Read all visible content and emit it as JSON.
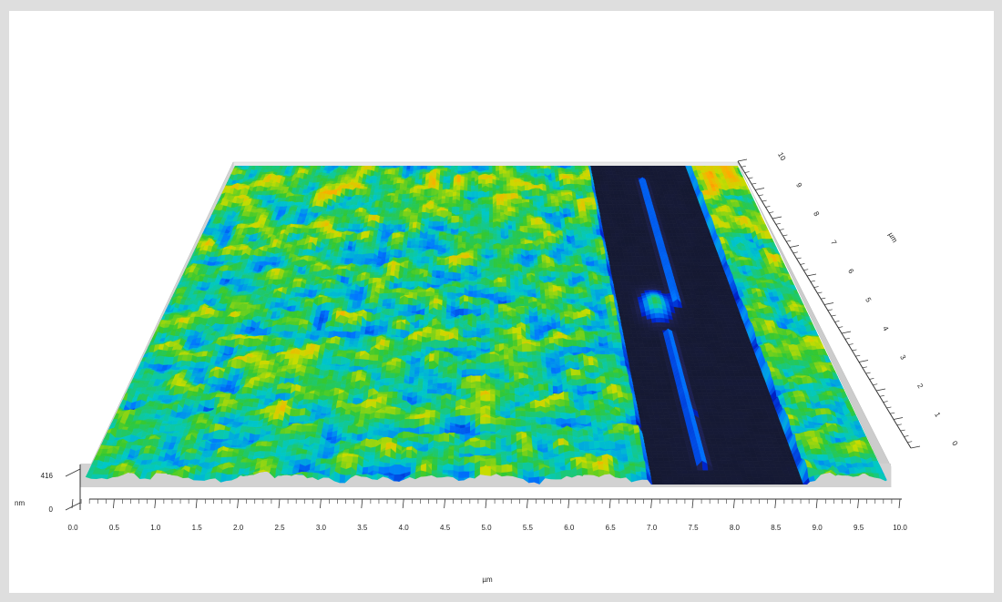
{
  "chart_data": {
    "type": "surface3d",
    "title": "",
    "x_axis": {
      "unit": "µm",
      "range": [
        0,
        10
      ],
      "ticks": [
        "0.0",
        "0.5",
        "1.0",
        "1.5",
        "2.0",
        "2.5",
        "3.0",
        "3.5",
        "4.0",
        "4.5",
        "5.0",
        "5.5",
        "6.0",
        "6.5",
        "7.0",
        "7.5",
        "8.0",
        "8.5",
        "9.0",
        "9.5",
        "10.0"
      ]
    },
    "y_axis": {
      "unit": "µm",
      "range": [
        0,
        10
      ],
      "ticks": [
        "0",
        "1",
        "2",
        "3",
        "4",
        "5",
        "6",
        "7",
        "8",
        "9",
        "10"
      ]
    },
    "z_axis": {
      "unit": "nm",
      "range": [
        0,
        416
      ],
      "ticks": [
        "0",
        "416"
      ]
    },
    "colormap": [
      "#000a3c",
      "#0020c8",
      "#0078ff",
      "#00c8c8",
      "#32c832",
      "#c8dc00",
      "#ffaa00",
      "#e63c14",
      "#ffffff"
    ],
    "features": {
      "trench_x_range_um": [
        7.0,
        9.0
      ],
      "trench_floor_color": "#14182e"
    }
  }
}
